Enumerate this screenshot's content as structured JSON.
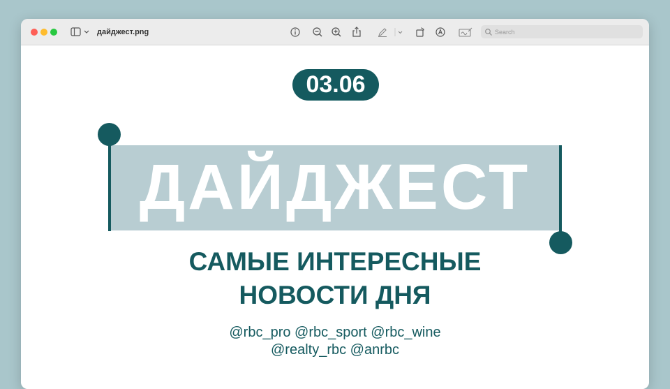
{
  "window": {
    "filename": "дайджест.png",
    "search_placeholder": "Search"
  },
  "toolbar": {
    "icons": [
      "info-icon",
      "zoom-out-icon",
      "zoom-in-icon",
      "share-icon",
      "markup-pen-icon",
      "chevron-down-icon",
      "rotate-icon",
      "markup-icon",
      "signature-icon"
    ]
  },
  "image": {
    "date": "03.06",
    "title": "ДАЙДЖЕСТ",
    "subtitle_line1": "САМЫЕ ИНТЕРЕСНЫЕ",
    "subtitle_line2": "НОВОСТИ ДНЯ",
    "handles_line1": "@rbc_pro @rbc_sport @rbc_wine",
    "handles_line2": "@realty_rbc @anrbc"
  },
  "colors": {
    "accent": "#155a5f",
    "title_band": "#b8cdd2",
    "desktop": "#a9c6cb"
  }
}
